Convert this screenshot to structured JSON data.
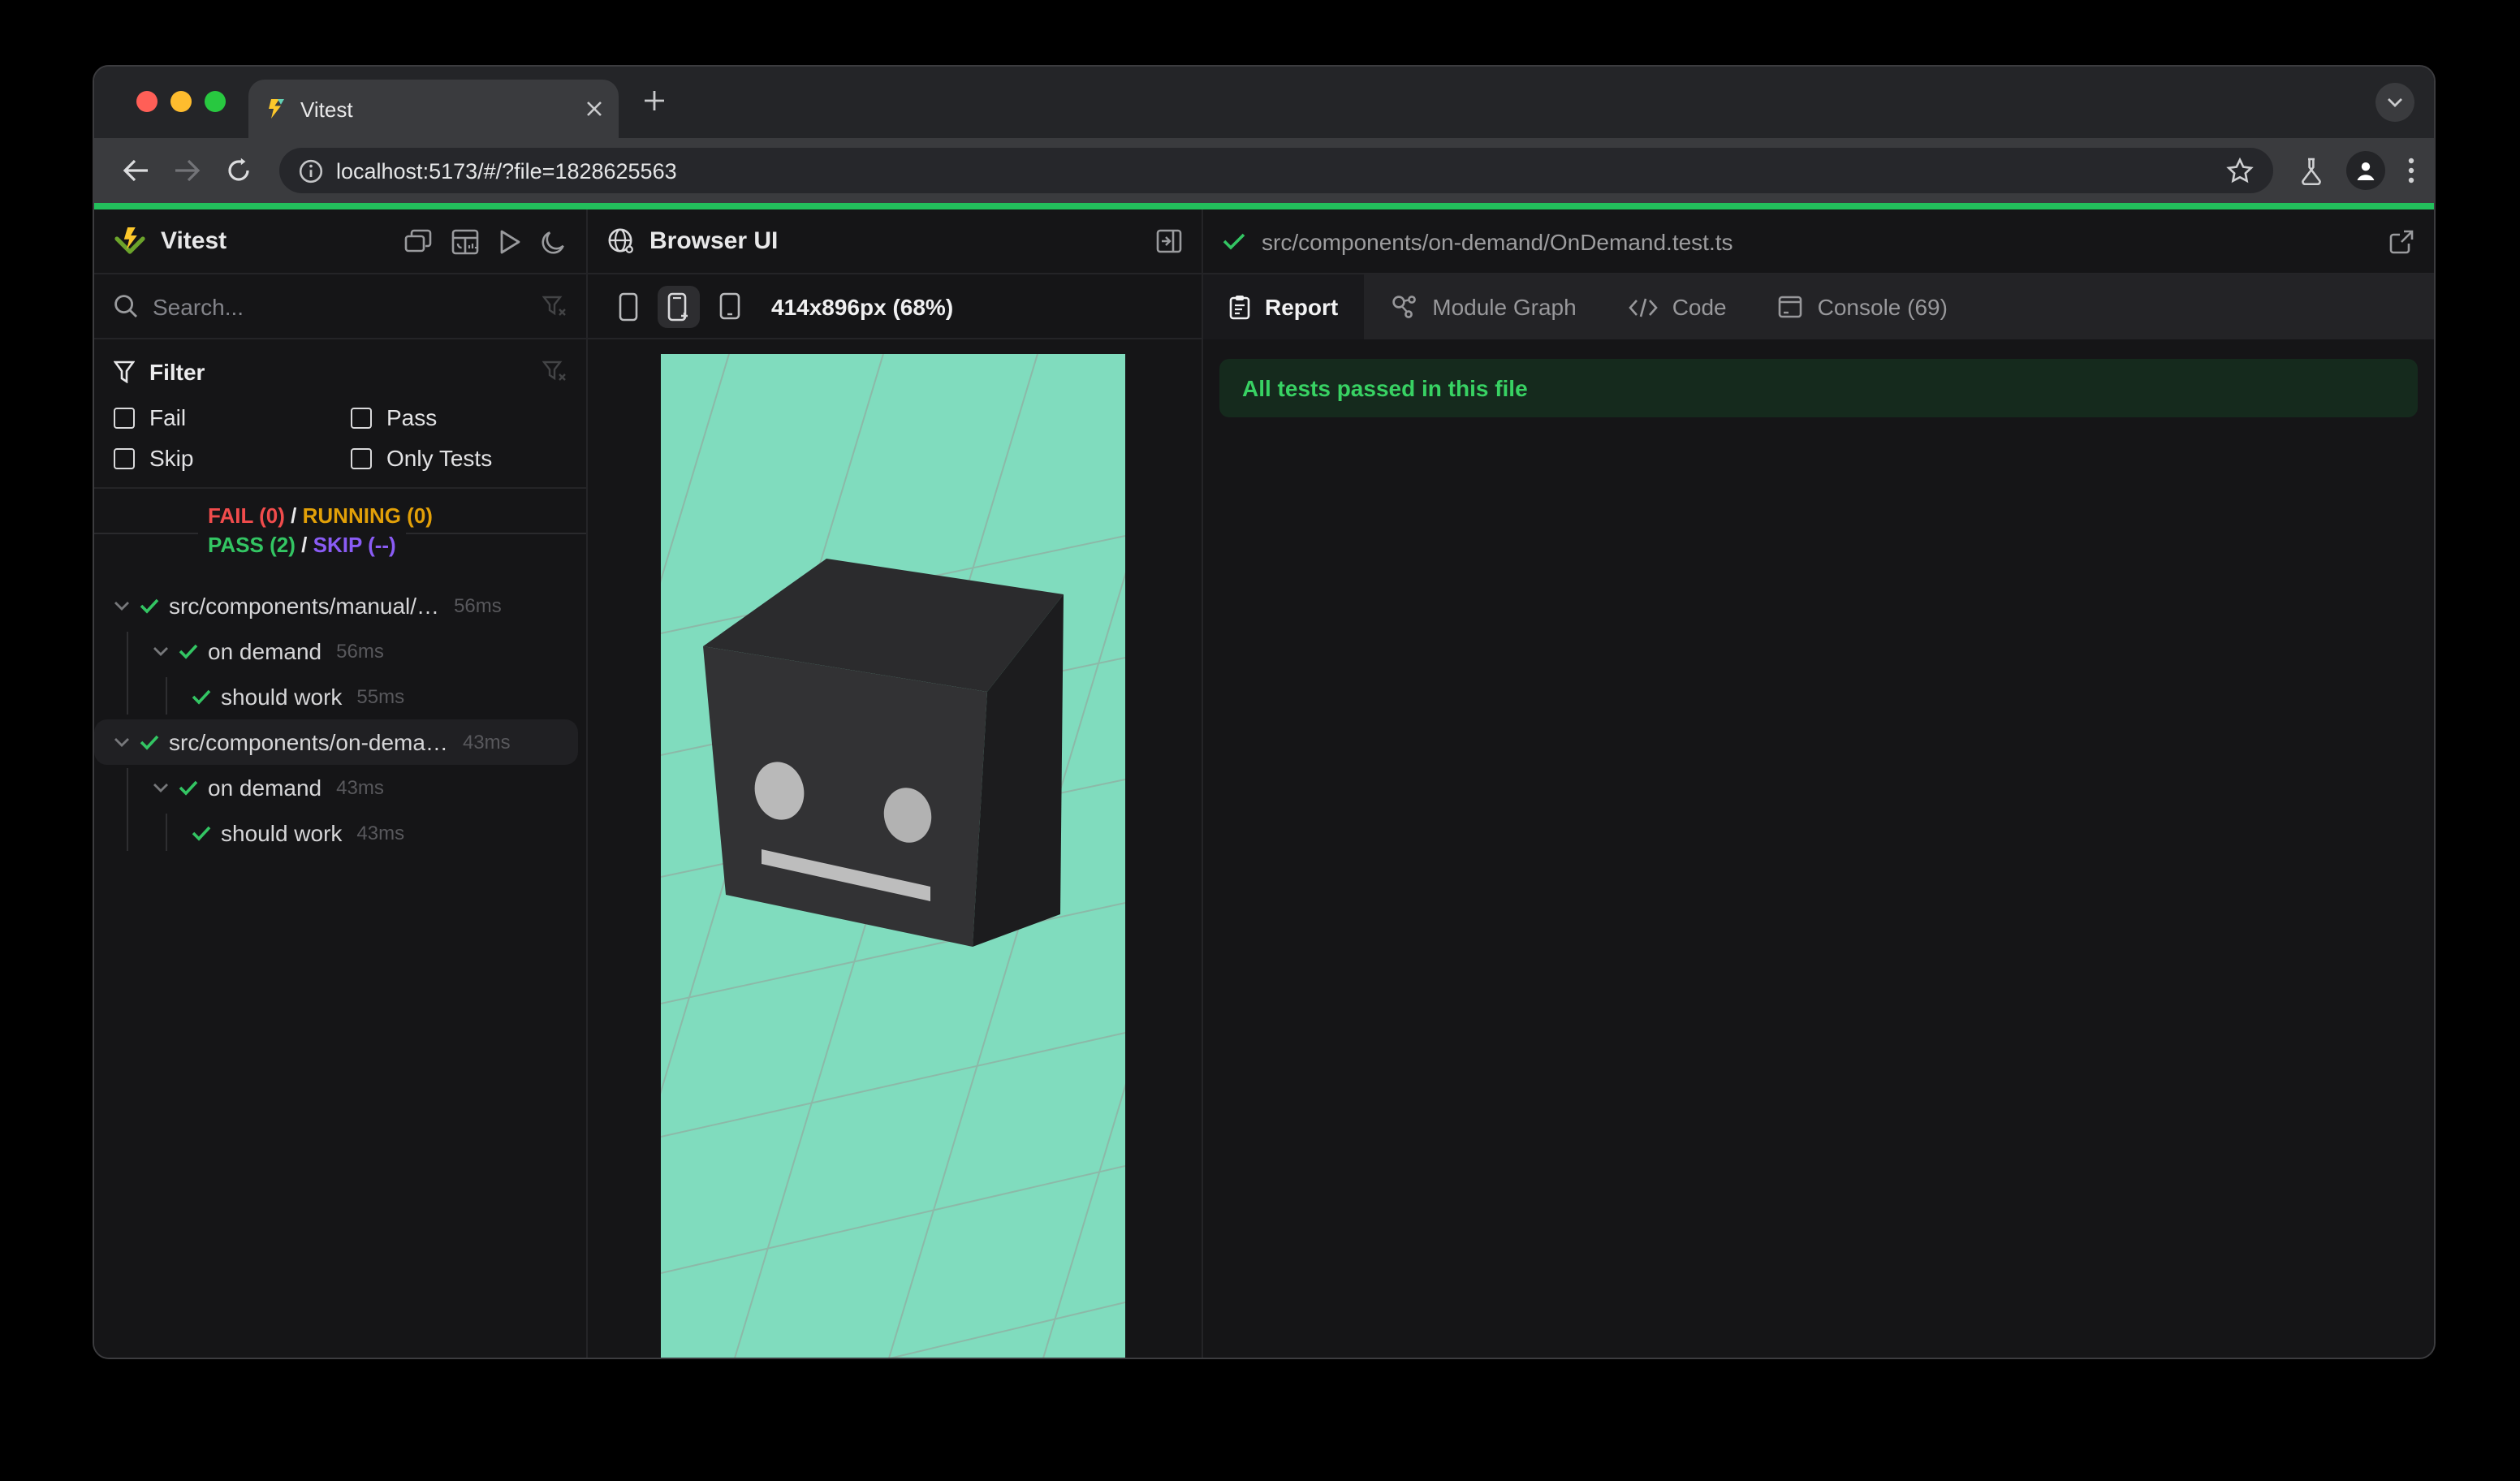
{
  "browser": {
    "tab_title": "Vitest",
    "new_tab_label": "+",
    "url": "localhost:5173/#/?file=1828625563"
  },
  "sidebar": {
    "app_name": "Vitest",
    "search_placeholder": "Search...",
    "filter": {
      "title": "Filter",
      "options": [
        {
          "label": "Fail"
        },
        {
          "label": "Pass"
        },
        {
          "label": "Skip"
        },
        {
          "label": "Only Tests"
        }
      ]
    },
    "summary": {
      "fail": "FAIL (0)",
      "running": "RUNNING (0)",
      "pass": "PASS (2)",
      "skip": "SKIP (--)",
      "separator": "/"
    },
    "tree": [
      {
        "label": "src/components/manual/…",
        "duration": "56ms"
      },
      {
        "label": "on demand",
        "duration": "56ms"
      },
      {
        "label": "should work",
        "duration": "55ms"
      },
      {
        "label": "src/components/on-dema…",
        "duration": "43ms"
      },
      {
        "label": "on demand",
        "duration": "43ms"
      },
      {
        "label": "should work",
        "duration": "43ms"
      }
    ]
  },
  "preview": {
    "title": "Browser UI",
    "viewport_label": "414x896px (68%)",
    "viewport_bg": "#80dcbe"
  },
  "report": {
    "file_path": "src/components/on-demand/OnDemand.test.ts",
    "tabs": [
      {
        "label": "Report"
      },
      {
        "label": "Module Graph"
      },
      {
        "label": "Code"
      },
      {
        "label": "Console (69)"
      }
    ],
    "banner": "All tests passed in this file"
  },
  "colors": {
    "accent_green": "#23bf5c",
    "pass_green": "#33c563",
    "fail_red": "#f14c4c",
    "running_amber": "#e2a008",
    "skip_purple": "#8a5cf5",
    "banner_bg": "#152a1d",
    "viewport_teal": "#80dcbe"
  }
}
